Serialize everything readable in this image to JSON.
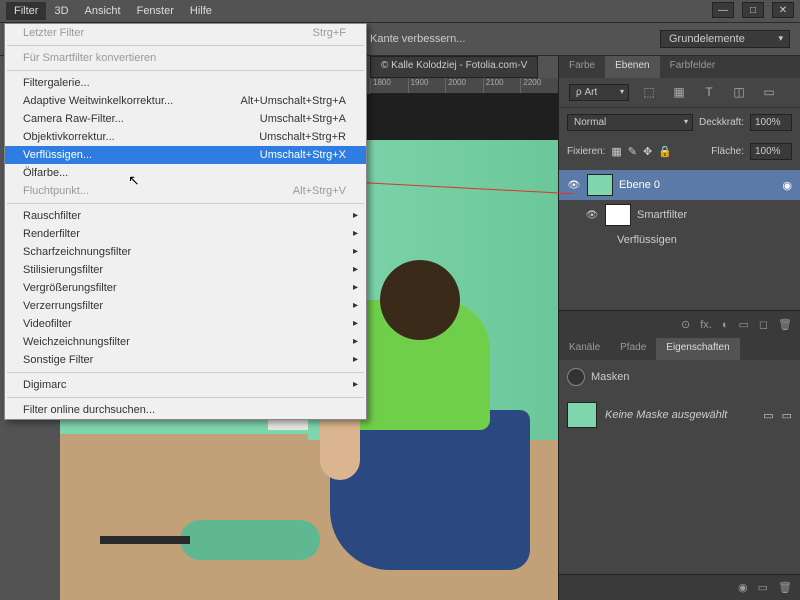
{
  "menubar": [
    "Filter",
    "3D",
    "Ansicht",
    "Fenster",
    "Hilfe"
  ],
  "active_menu": 0,
  "options": {
    "refine": "Kante verbessern...",
    "preset": "Grundelemente"
  },
  "doc_tab": "© Kalle Kolodziej - Fotolia.com-V",
  "ruler": [
    "1800",
    "1900",
    "2000",
    "2100",
    "2200"
  ],
  "dropdown": [
    {
      "label": "Letzter Filter",
      "shortcut": "Strg+F",
      "disabled": true
    },
    {
      "sep": true
    },
    {
      "label": "Für Smartfilter konvertieren",
      "disabled": true
    },
    {
      "sep": true
    },
    {
      "label": "Filtergalerie..."
    },
    {
      "label": "Adaptive Weitwinkelkorrektur...",
      "shortcut": "Alt+Umschalt+Strg+A"
    },
    {
      "label": "Camera Raw-Filter...",
      "shortcut": "Umschalt+Strg+A"
    },
    {
      "label": "Objektivkorrektur...",
      "shortcut": "Umschalt+Strg+R"
    },
    {
      "label": "Verflüssigen...",
      "shortcut": "Umschalt+Strg+X",
      "selected": true
    },
    {
      "label": "Ölfarbe..."
    },
    {
      "label": "Fluchtpunkt...",
      "shortcut": "Alt+Strg+V",
      "disabled": true
    },
    {
      "sep": true
    },
    {
      "label": "Rauschfilter",
      "sub": true
    },
    {
      "label": "Renderfilter",
      "sub": true
    },
    {
      "label": "Scharfzeichnungsfilter",
      "sub": true
    },
    {
      "label": "Stilisierungsfilter",
      "sub": true
    },
    {
      "label": "Vergrößerungsfilter",
      "sub": true
    },
    {
      "label": "Verzerrungsfilter",
      "sub": true
    },
    {
      "label": "Videofilter",
      "sub": true
    },
    {
      "label": "Weichzeichnungsfilter",
      "sub": true
    },
    {
      "label": "Sonstige Filter",
      "sub": true
    },
    {
      "sep": true
    },
    {
      "label": "Digimarc",
      "sub": true
    },
    {
      "sep": true
    },
    {
      "label": "Filter online durchsuchen..."
    }
  ],
  "panels": {
    "tabs1": [
      "Farbe",
      "Ebenen",
      "Farbfelder"
    ],
    "active1": 1,
    "tool_icons": [
      "⬚",
      "▦",
      "✦",
      "T",
      "◫",
      "▭"
    ],
    "eyedrop": "ρ Art",
    "blend": "Normal",
    "opacity_label": "Deckkraft:",
    "opacity": "100%",
    "lock_label": "Fixieren:",
    "fill_label": "Fläche:",
    "fill": "100%",
    "layer0": "Ebene 0",
    "smartfilter": "Smartfilter",
    "liquify": "Verflüssigen",
    "footer_icons": [
      "⊙",
      "fx.",
      "◐",
      "▭",
      "◻",
      "🗑"
    ],
    "tabs2": [
      "Kanäle",
      "Pfade",
      "Eigenschaften"
    ],
    "active2": 2,
    "masks": "Masken",
    "nomask": "Keine Maske ausgewählt",
    "props_footer": [
      "◉",
      "▭",
      "🗑"
    ]
  }
}
